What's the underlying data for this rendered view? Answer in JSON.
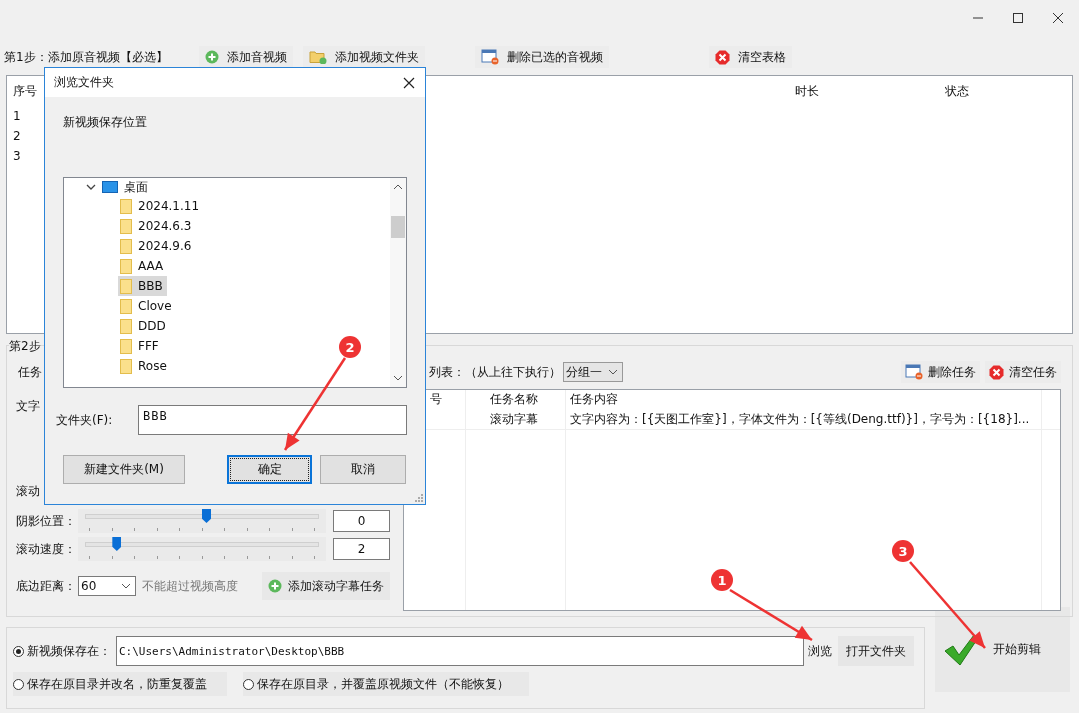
{
  "step1": {
    "label": "第1步：添加原音视频【必选】",
    "buttons": [
      {
        "label": "添加音视频",
        "kind": "add"
      },
      {
        "label": "添加视频文件夹",
        "kind": "folder"
      },
      {
        "label": "删除已选的音视频",
        "kind": "delete"
      },
      {
        "label": "清空表格",
        "kind": "clear"
      }
    ]
  },
  "file_table": {
    "columns": [
      "序号",
      "时长",
      "状态"
    ],
    "rows": [
      "1",
      "2",
      "3"
    ]
  },
  "step2": {
    "title": "第2步",
    "labels": [
      "任务",
      "文字",
      "滚动"
    ],
    "sliders": [
      {
        "label": "阴影位置：",
        "level": 0.5,
        "value": "0"
      },
      {
        "label": "滚动速度：",
        "level": 0.12,
        "value": "2"
      }
    ],
    "bottom_distance": {
      "label": "底边距离：",
      "value": "60",
      "hint": "不能超过视频高度"
    },
    "add_button": "添加滚动字幕任务"
  },
  "task_list": {
    "label": "列表：（从上往下执行）",
    "group": "分组一",
    "buttons": [
      {
        "label": "删除任务",
        "kind": "delete"
      },
      {
        "label": "清空任务",
        "kind": "clear"
      }
    ],
    "columns": [
      "号",
      "任务名称",
      "任务内容"
    ],
    "rows": [
      {
        "name": "滚动字幕",
        "content": "文字内容为：[{天图工作室}]，字体文件为：[{等线(Deng.ttf)}]，字号为：[{18}]..."
      }
    ]
  },
  "output": {
    "options": [
      {
        "label": "新视频保存在：",
        "selected": true
      },
      {
        "label": "保存在原目录并改名，防重复覆盖",
        "selected": false
      },
      {
        "label": "保存在原目录，并覆盖原视频文件（不能恢复）",
        "selected": false
      }
    ],
    "path": "C:\\Users\\Administrator\\Desktop\\BBB",
    "browse": "浏览",
    "open_folder": "打开文件夹",
    "start": "开始剪辑"
  },
  "dialog": {
    "title": "浏览文件夹",
    "prompt": "新视频保存位置",
    "tree": [
      {
        "label": "桌面",
        "expanded": true,
        "children": [
          {
            "label": "2024.1.11",
            "selected": false
          },
          {
            "label": "2024.6.3",
            "selected": false
          },
          {
            "label": "2024.9.6",
            "selected": false
          },
          {
            "label": "AAA",
            "selected": false
          },
          {
            "label": "BBB",
            "selected": true
          },
          {
            "label": "Clove",
            "selected": false
          },
          {
            "label": "DDD",
            "selected": false
          },
          {
            "label": "FFF",
            "selected": false
          },
          {
            "label": "Rose",
            "selected": false
          }
        ]
      }
    ],
    "folder_label": "文件夹(F):",
    "folder_value": "BBB",
    "buttons": [
      {
        "label": "新建文件夹(M)",
        "focused": false
      },
      {
        "label": "确定",
        "focused": true
      },
      {
        "label": "取消",
        "focused": false
      }
    ]
  },
  "annotations": [
    {
      "number": "1"
    },
    {
      "number": "2"
    },
    {
      "number": "3"
    }
  ]
}
